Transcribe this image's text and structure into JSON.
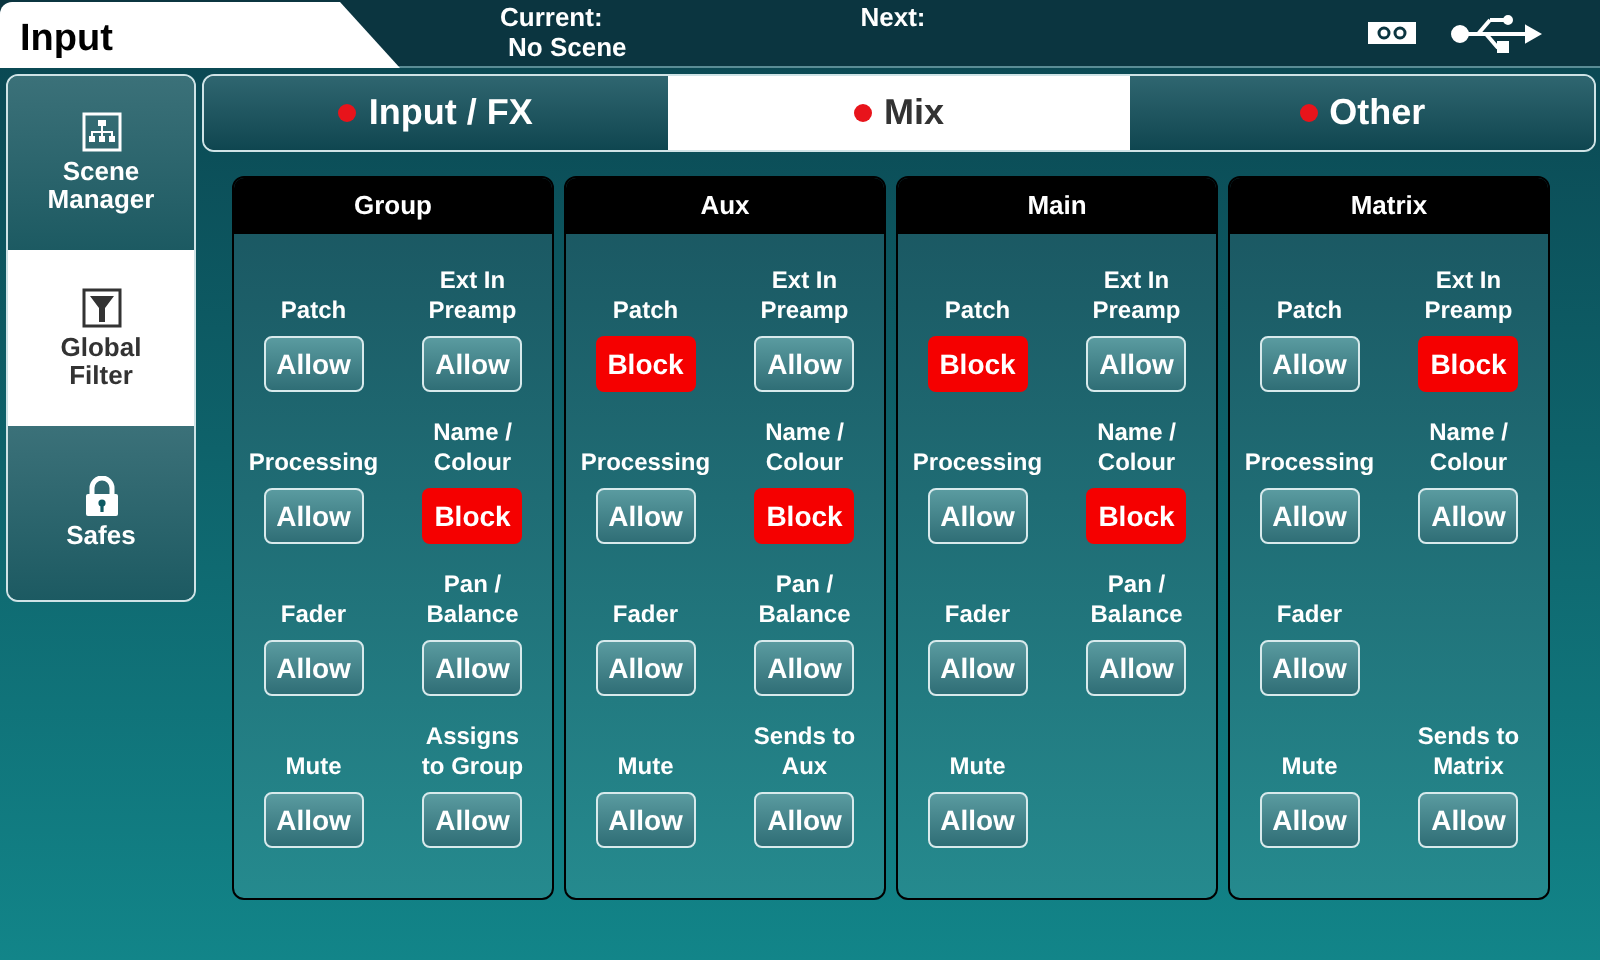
{
  "header": {
    "title": "Input",
    "current_label": "Current:",
    "current_value": "No Scene",
    "next_label": "Next:"
  },
  "sidebar": {
    "items": [
      {
        "label": "Scene Manager",
        "kind": "network",
        "selected": false
      },
      {
        "label": "Global Filter",
        "kind": "filter",
        "selected": true
      },
      {
        "label": "Safes",
        "kind": "lock",
        "selected": false
      }
    ]
  },
  "tabs": [
    {
      "label": "Input / FX",
      "selected": false
    },
    {
      "label": "Mix",
      "selected": true
    },
    {
      "label": "Other",
      "selected": false
    }
  ],
  "panels": [
    {
      "title": "Group",
      "cells": [
        {
          "kind": "toggle",
          "label": "Patch",
          "value": "Allow",
          "blocked": false
        },
        {
          "kind": "toggle",
          "label": "Ext In\nPreamp",
          "value": "Allow",
          "blocked": false
        },
        {
          "kind": "toggle",
          "label": "Processing",
          "value": "Allow",
          "blocked": false
        },
        {
          "kind": "toggle",
          "label": "Name /\nColour",
          "value": "Block",
          "blocked": true
        },
        {
          "kind": "toggle",
          "label": "Fader",
          "value": "Allow",
          "blocked": false
        },
        {
          "kind": "toggle",
          "label": "Pan /\nBalance",
          "value": "Allow",
          "blocked": false
        },
        {
          "kind": "toggle",
          "label": "Mute",
          "value": "Allow",
          "blocked": false
        },
        {
          "kind": "toggle",
          "label": "Assigns\nto Group",
          "value": "Allow",
          "blocked": false
        }
      ]
    },
    {
      "title": "Aux",
      "cells": [
        {
          "kind": "toggle",
          "label": "Patch",
          "value": "Block",
          "blocked": true
        },
        {
          "kind": "toggle",
          "label": "Ext In\nPreamp",
          "value": "Allow",
          "blocked": false
        },
        {
          "kind": "toggle",
          "label": "Processing",
          "value": "Allow",
          "blocked": false
        },
        {
          "kind": "toggle",
          "label": "Name /\nColour",
          "value": "Block",
          "blocked": true
        },
        {
          "kind": "toggle",
          "label": "Fader",
          "value": "Allow",
          "blocked": false
        },
        {
          "kind": "toggle",
          "label": "Pan /\nBalance",
          "value": "Allow",
          "blocked": false
        },
        {
          "kind": "toggle",
          "label": "Mute",
          "value": "Allow",
          "blocked": false
        },
        {
          "kind": "toggle",
          "label": "Sends to\nAux",
          "value": "Allow",
          "blocked": false
        }
      ]
    },
    {
      "title": "Main",
      "cells": [
        {
          "kind": "toggle",
          "label": "Patch",
          "value": "Block",
          "blocked": true
        },
        {
          "kind": "toggle",
          "label": "Ext In\nPreamp",
          "value": "Allow",
          "blocked": false
        },
        {
          "kind": "toggle",
          "label": "Processing",
          "value": "Allow",
          "blocked": false
        },
        {
          "kind": "toggle",
          "label": "Name /\nColour",
          "value": "Block",
          "blocked": true
        },
        {
          "kind": "toggle",
          "label": "Fader",
          "value": "Allow",
          "blocked": false
        },
        {
          "kind": "toggle",
          "label": "Pan /\nBalance",
          "value": "Allow",
          "blocked": false
        },
        {
          "kind": "toggle",
          "label": "Mute",
          "value": "Allow",
          "blocked": false
        },
        {
          "kind": "blank"
        }
      ]
    },
    {
      "title": "Matrix",
      "cells": [
        {
          "kind": "toggle",
          "label": "Patch",
          "value": "Allow",
          "blocked": false
        },
        {
          "kind": "toggle",
          "label": "Ext In\nPreamp",
          "value": "Block",
          "blocked": true
        },
        {
          "kind": "toggle",
          "label": "Processing",
          "value": "Allow",
          "blocked": false
        },
        {
          "kind": "toggle",
          "label": "Name /\nColour",
          "value": "Allow",
          "blocked": false
        },
        {
          "kind": "toggle",
          "label": "Fader",
          "value": "Allow",
          "blocked": false
        },
        {
          "kind": "blank"
        },
        {
          "kind": "toggle",
          "label": "Mute",
          "value": "Allow",
          "blocked": false
        },
        {
          "kind": "toggle",
          "label": "Sends to\nMatrix",
          "value": "Allow",
          "blocked": false
        }
      ]
    }
  ]
}
